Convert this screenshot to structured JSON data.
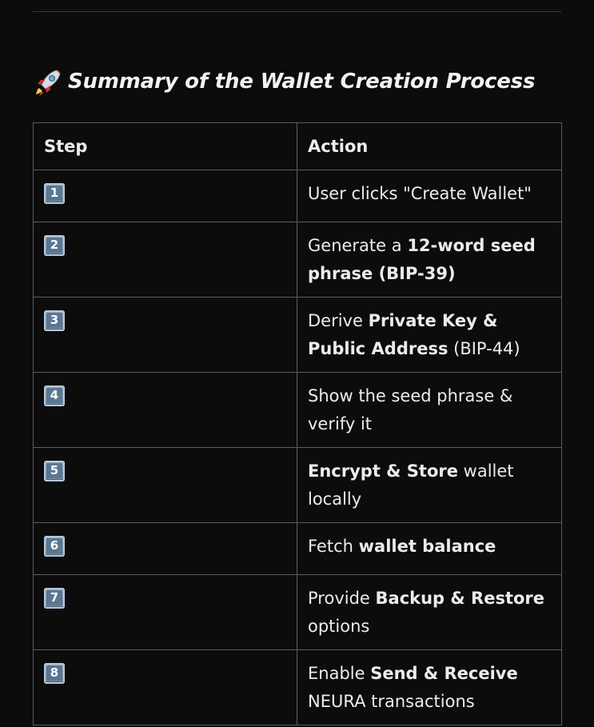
{
  "title": {
    "icon": "rocket-icon",
    "text": "Summary of the Wallet Creation Process"
  },
  "table": {
    "headers": {
      "step": "Step",
      "action": "Action"
    },
    "rows": [
      {
        "step": "1",
        "icon": "keycap-1-icon",
        "parts": [
          {
            "text": "User clicks \"Create Wallet\"",
            "bold": false
          }
        ]
      },
      {
        "step": "2",
        "icon": "keycap-2-icon",
        "parts": [
          {
            "text": "Generate a ",
            "bold": false
          },
          {
            "text": "12-word seed phrase (BIP-39)",
            "bold": true
          }
        ]
      },
      {
        "step": "3",
        "icon": "keycap-3-icon",
        "parts": [
          {
            "text": "Derive ",
            "bold": false
          },
          {
            "text": "Private Key & Public Address",
            "bold": true
          },
          {
            "text": " (BIP-44)",
            "bold": false
          }
        ]
      },
      {
        "step": "4",
        "icon": "keycap-4-icon",
        "parts": [
          {
            "text": "Show the seed phrase & verify it",
            "bold": false
          }
        ]
      },
      {
        "step": "5",
        "icon": "keycap-5-icon",
        "parts": [
          {
            "text": "Encrypt & Store",
            "bold": true
          },
          {
            "text": " wallet locally",
            "bold": false
          }
        ]
      },
      {
        "step": "6",
        "icon": "keycap-6-icon",
        "parts": [
          {
            "text": "Fetch ",
            "bold": false
          },
          {
            "text": "wallet balance",
            "bold": true
          }
        ]
      },
      {
        "step": "7",
        "icon": "keycap-7-icon",
        "parts": [
          {
            "text": "Provide ",
            "bold": false
          },
          {
            "text": "Backup & Restore",
            "bold": true
          },
          {
            "text": " options",
            "bold": false
          }
        ]
      },
      {
        "step": "8",
        "icon": "keycap-8-icon",
        "parts": [
          {
            "text": "Enable ",
            "bold": false
          },
          {
            "text": "Send & Receive",
            "bold": true
          },
          {
            "text": " NEURA transactions",
            "bold": false
          }
        ]
      }
    ]
  }
}
